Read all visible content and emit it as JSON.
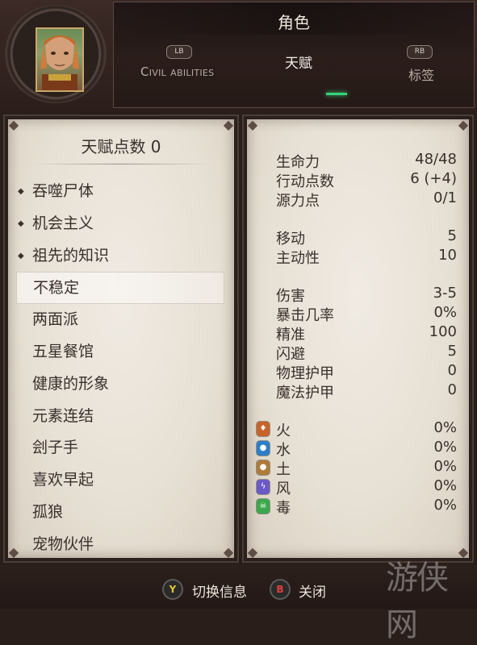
{
  "header": {
    "title": "角色",
    "tabs": {
      "left": {
        "badge": "LB",
        "label": "Civil abilities"
      },
      "active": {
        "label": "天赋"
      },
      "right": {
        "badge": "RB",
        "label": "标签"
      }
    }
  },
  "talents": {
    "points_label": "天赋点数 0",
    "items": [
      {
        "label": "吞噬尸体",
        "marked": true
      },
      {
        "label": "机会主义",
        "marked": true
      },
      {
        "label": "祖先的知识",
        "marked": true
      },
      {
        "label": "不稳定",
        "selected": true
      },
      {
        "label": "两面派"
      },
      {
        "label": "五星餐馆"
      },
      {
        "label": "健康的形象"
      },
      {
        "label": "元素连结"
      },
      {
        "label": "刽子手"
      },
      {
        "label": "喜欢早起"
      },
      {
        "label": "孤狼"
      },
      {
        "label": "宠物伙伴"
      }
    ]
  },
  "stats": {
    "vitality": {
      "label": "生命力",
      "value": "48/48"
    },
    "action_points": {
      "label": "行动点数",
      "value": "6 (+4)"
    },
    "source_points": {
      "label": "源力点",
      "value": "0/1"
    },
    "movement": {
      "label": "移动",
      "value": "5"
    },
    "initiative": {
      "label": "主动性",
      "value": "10"
    },
    "damage": {
      "label": "伤害",
      "value": "3-5"
    },
    "crit_chance": {
      "label": "暴击几率",
      "value": "0%"
    },
    "accuracy": {
      "label": "精准",
      "value": "100"
    },
    "dodge": {
      "label": "闪避",
      "value": "5"
    },
    "physical_armor": {
      "label": "物理护甲",
      "value": "0"
    },
    "magic_armor": {
      "label": "魔法护甲",
      "value": "0"
    }
  },
  "resistances": [
    {
      "label": "火",
      "value": "0%",
      "icon": "fire-icon",
      "color": "#c8642a"
    },
    {
      "label": "水",
      "value": "0%",
      "icon": "water-icon",
      "color": "#2a7fc8"
    },
    {
      "label": "土",
      "value": "0%",
      "icon": "earth-icon",
      "color": "#b07a3a"
    },
    {
      "label": "风",
      "value": "0%",
      "icon": "air-icon",
      "color": "#6a5ac8"
    },
    {
      "label": "毒",
      "value": "0%",
      "icon": "poison-icon",
      "color": "#3aa84a"
    }
  ],
  "footer": {
    "switch": {
      "button": "Y",
      "label": "切换信息",
      "color": "#c9a52a"
    },
    "close": {
      "button": "B",
      "label": "关闭",
      "color": "#c8302a"
    }
  },
  "watermark": "游侠网"
}
